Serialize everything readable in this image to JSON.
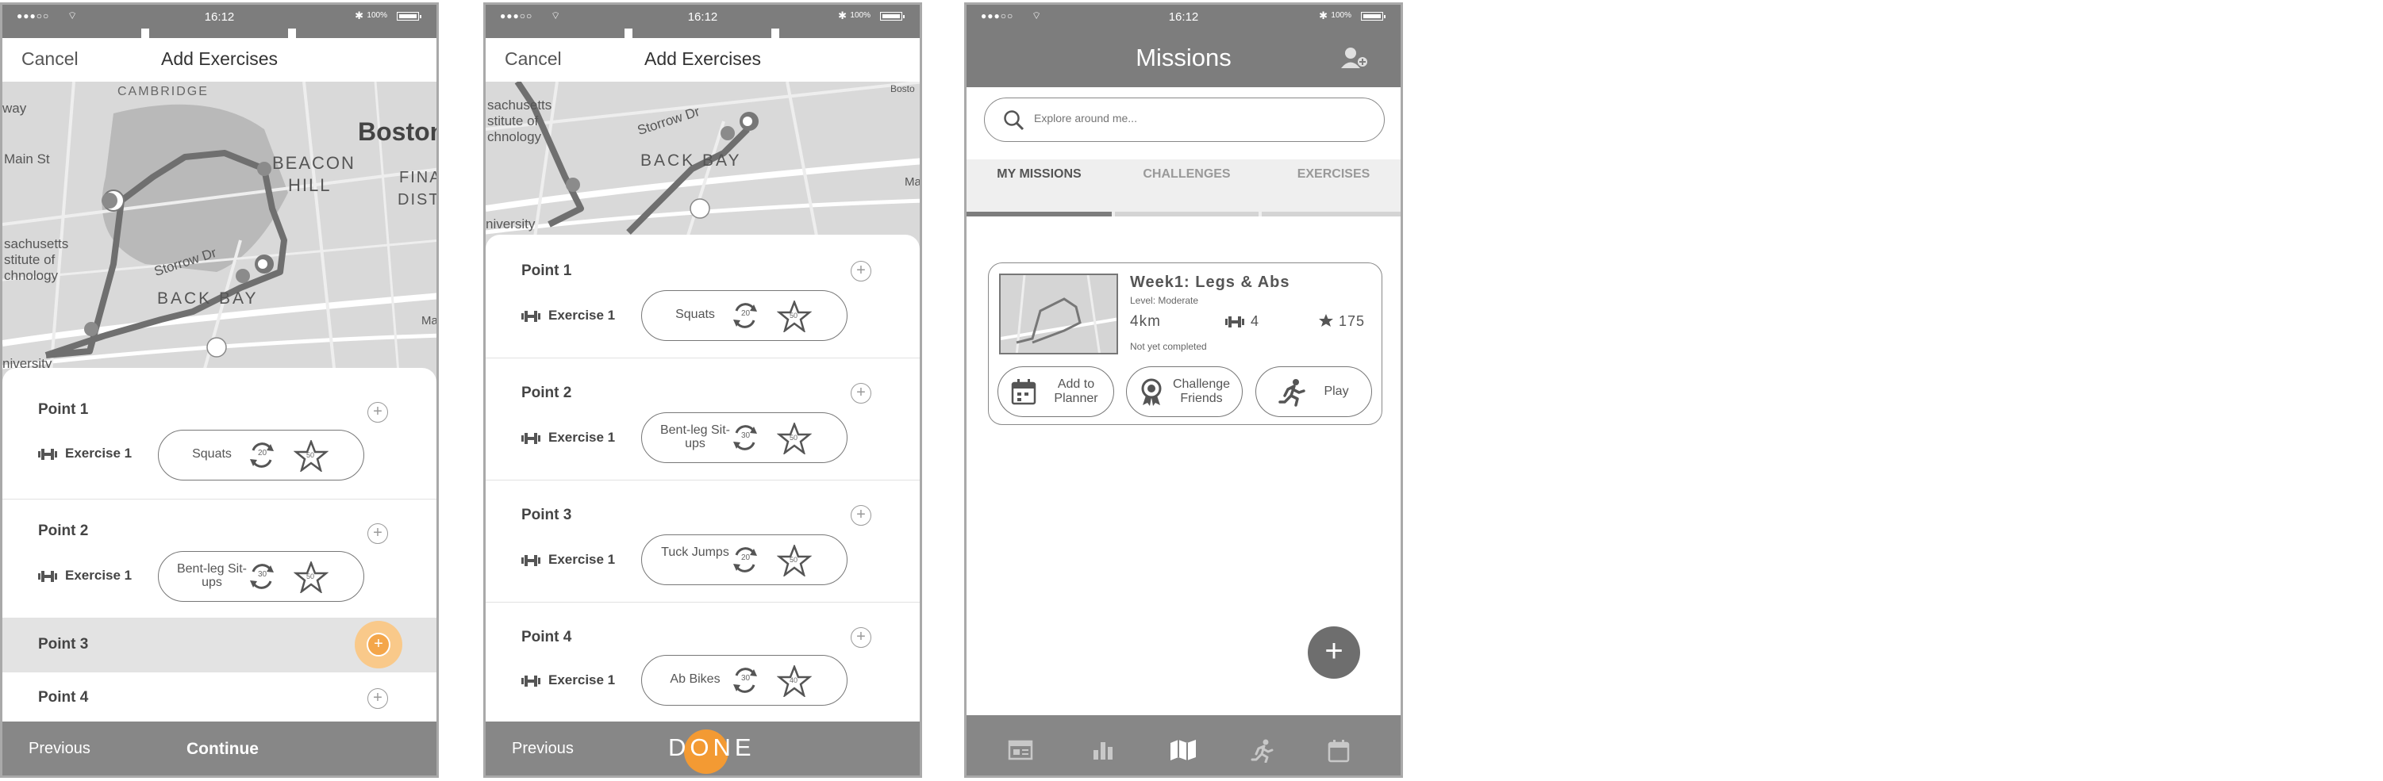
{
  "status": {
    "signal": "●●●○○",
    "time": "16:12",
    "battery": "100%"
  },
  "screen1": {
    "nav": {
      "cancel": "Cancel",
      "title": "Add Exercises"
    },
    "map_labels": [
      "CAMBRIDGE",
      "Boston",
      "BEACON",
      "HILL",
      "FINAN",
      "DIST",
      "Main St",
      "sachusetts",
      "stitute of",
      "chnology",
      "Storrow Dr",
      "BACK BAY",
      "niversity",
      "way",
      "Ma"
    ],
    "points": [
      {
        "title": "Point 1",
        "exercise": "Exercise 1",
        "name": "Squats",
        "reps": "20",
        "score": "50"
      },
      {
        "title": "Point 2",
        "exercise": "Exercise 1",
        "name": "Bent-leg Sit-ups",
        "reps": "30",
        "score": "50"
      }
    ],
    "point3": "Point 3",
    "point4": "Point 4",
    "footer": {
      "previous": "Previous",
      "continue": "Continue"
    }
  },
  "screen2": {
    "nav": {
      "cancel": "Cancel",
      "title": "Add Exercises"
    },
    "map_labels": [
      "sachusetts",
      "stitute of",
      "chnology",
      "Storrow Dr",
      "BACK BAY",
      "niversity",
      "Ma",
      "Bosto"
    ],
    "points": [
      {
        "title": "Point 1",
        "exercise": "Exercise 1",
        "name": "Squats",
        "reps": "20",
        "score": "50"
      },
      {
        "title": "Point 2",
        "exercise": "Exercise 1",
        "name": "Bent-leg Sit-ups",
        "reps": "30",
        "score": "50"
      },
      {
        "title": "Point 3",
        "exercise": "Exercise 1",
        "name": "Tuck Jumps",
        "reps": "20",
        "score": "50"
      },
      {
        "title": "Point 4",
        "exercise": "Exercise 1",
        "name": "Ab Bikes",
        "reps": "30",
        "score": "40"
      }
    ],
    "footer": {
      "previous": "Previous",
      "done": "DONE"
    }
  },
  "screen3": {
    "title": "Missions",
    "search_placeholder": "Explore around me...",
    "tabs": [
      "MY MISSIONS",
      "CHALLENGES",
      "EXERCISES"
    ],
    "mission": {
      "title": "Week1: Legs & Abs",
      "level": "Level: Moderate",
      "distance": "4km",
      "count": "4",
      "score": "175",
      "status": "Not yet completed",
      "buttons": [
        "Add to Planner",
        "Challenge Friends",
        "Play"
      ]
    },
    "fab": "+"
  },
  "icons": [
    "wifi-icon",
    "bluetooth-icon",
    "battery-icon",
    "dumbbell-icon",
    "repeat-icon",
    "star-icon",
    "plus-icon",
    "search-icon",
    "add-friend-icon",
    "calendar-icon",
    "award-icon",
    "runner-icon",
    "news-icon",
    "bar-chart-icon",
    "map-icon"
  ]
}
